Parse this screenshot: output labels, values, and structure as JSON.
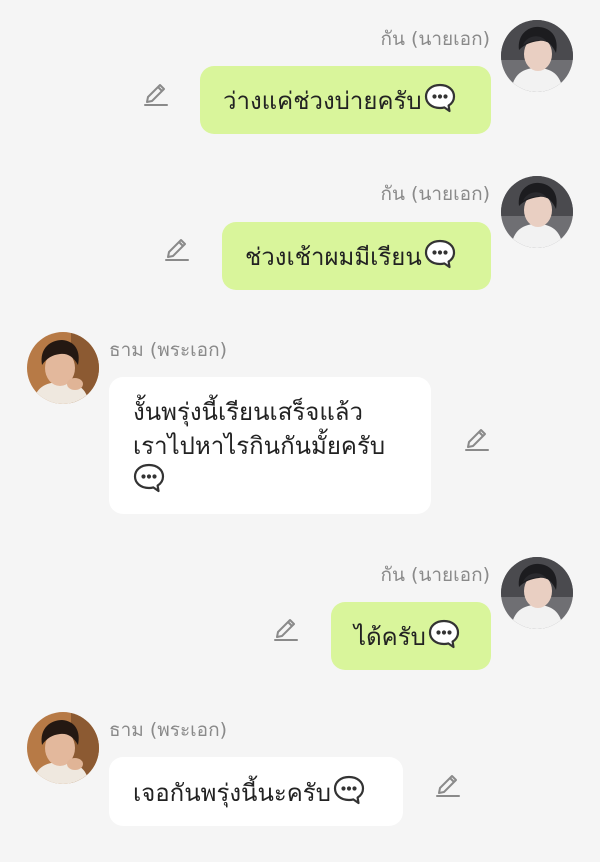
{
  "conversation": {
    "messages": [
      {
        "sender": "กัน (นายเอก)",
        "text": "ว่างแค่ช่วงบ่ายครับ",
        "side": "right",
        "icon": "speech-bubble-emoji"
      },
      {
        "sender": "กัน (นายเอก)",
        "text": "ช่วงเช้าผมมีเรียน",
        "side": "right",
        "icon": "speech-bubble-emoji"
      },
      {
        "sender": "ธาม (พระเอก)",
        "text": "งั้นพรุ่งนี้เรียนเสร็จแล้ว",
        "text2": "เราไปหาไรกินกันมั้ยครับ",
        "side": "left",
        "icon": "speech-bubble-emoji"
      },
      {
        "sender": "กัน (นายเอก)",
        "text": "ได้ครับ",
        "side": "right",
        "icon": "speech-bubble-emoji"
      },
      {
        "sender": "ธาม (พระเอก)",
        "text": "เจอกันพรุ่งนี้นะครับ",
        "side": "left",
        "icon": "speech-bubble-emoji"
      }
    ]
  },
  "colors": {
    "background": "#f5f5f5",
    "outgoing_bubble": "#d9f59b",
    "incoming_bubble": "#ffffff",
    "name_text": "#8a8a8a",
    "message_text": "#222222"
  }
}
